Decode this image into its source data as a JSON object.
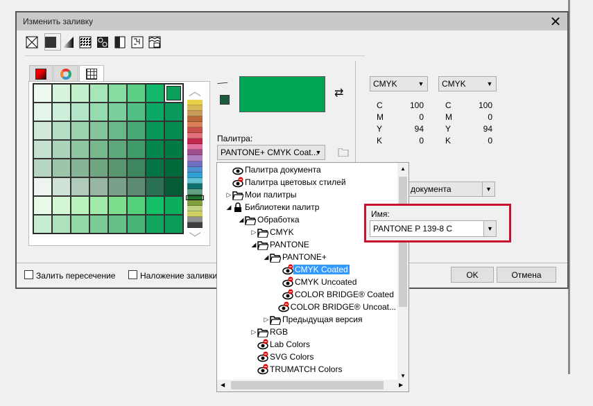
{
  "dialog": {
    "title": "Изменить заливку",
    "close": "✕"
  },
  "fill_types": [
    "no-fill-icon",
    "uniform-fill-icon",
    "fountain-fill-icon",
    "vector-pattern-icon",
    "bitmap-pattern-icon",
    "two-color-pattern-icon",
    "texture-fill-icon",
    "postscript-fill-icon"
  ],
  "tabs": [
    "color-viewers-tab",
    "color-harmonies-tab",
    "color-palettes-tab"
  ],
  "grid": [
    [
      "#eefaf0",
      "#d7f5dd",
      "#c2efcc",
      "#a6e6b8",
      "#86dca0",
      "#5ccf87",
      "#14b86a",
      "#0aa05a"
    ],
    [
      "#e3f4e8",
      "#cdeed8",
      "#b2e5c6",
      "#96dbb0",
      "#79cf9b",
      "#52c084",
      "#0ca866",
      "#079a5a"
    ],
    [
      "#cfe8d8",
      "#b5dfc5",
      "#9cd2b0",
      "#84c59e",
      "#6ab88a",
      "#48aa74",
      "#069658",
      "#058a50"
    ],
    [
      "#c4e2cf",
      "#a9d4b9",
      "#8fc6a2",
      "#77b88f",
      "#5ea97c",
      "#3f9b68",
      "#03864c",
      "#027a44"
    ],
    [
      "#b7d6c2",
      "#9cc6aa",
      "#85b596",
      "#70a582",
      "#58966f",
      "#3e8660",
      "#027543",
      "#016a3b"
    ],
    [
      "#eef4ef",
      "#d0e2d6",
      "#b0cbb9",
      "#97b6a2",
      "#7aa08a",
      "#5d8a72",
      "#2a7052",
      "#055d35"
    ],
    [
      "#e7fae7",
      "#d3f7d2",
      "#baf2bb",
      "#a0ebaa",
      "#7ddf8e",
      "#52d07a",
      "#14c066",
      "#0aae5c"
    ],
    [
      "#c7ebcf",
      "#ade2bb",
      "#92d7a6",
      "#7ccb94",
      "#64c085",
      "#48b473",
      "#10a65e",
      "#089c57"
    ]
  ],
  "strip": [
    "#e8d24a",
    "#d9b85a",
    "#c99a5a",
    "#b86a3a",
    "#d9805a",
    "#c9504a",
    "#e0707a",
    "#c02850",
    "#e070a0",
    "#a05090",
    "#b080c0",
    "#7070c0",
    "#5090d0",
    "#30a0d0",
    "#60c0d0",
    "#107070",
    "#60a080",
    "#207030",
    "#80a040",
    "#c0d080",
    "#d0d060",
    "#909090",
    "#404040"
  ],
  "current_color": "#00a651",
  "palette_label": "Палитра:",
  "palette_value": "PANTONE+ CMYK Coat...",
  "models": [
    {
      "model": "CMYK",
      "values": [
        [
          "C",
          "100"
        ],
        [
          "M",
          "0"
        ],
        [
          "Y",
          "94"
        ],
        [
          "K",
          "0"
        ]
      ]
    },
    {
      "model": "CMYK",
      "values": [
        [
          "C",
          "100"
        ],
        [
          "M",
          "0"
        ],
        [
          "Y",
          "94"
        ],
        [
          "K",
          "0"
        ]
      ]
    }
  ],
  "doc_palette": "документа",
  "name_label": "Имя:",
  "name_value": "PANTONE P 139-8 C",
  "highlight": "#c8102e",
  "fill_intersect": "Залить пересечение",
  "overprint": "Наложение заливки",
  "ok": "OK",
  "cancel": "Отмена",
  "tree": [
    {
      "d": 0,
      "e": "",
      "i": "eye",
      "t": "Палитра документа"
    },
    {
      "d": 0,
      "e": "",
      "i": "eyer",
      "t": "Палитра цветовых стилей"
    },
    {
      "d": 0,
      "e": "▷",
      "i": "folder",
      "t": "Мои палитры"
    },
    {
      "d": 0,
      "e": "◢",
      "i": "lock",
      "t": "Библиотеки палитр"
    },
    {
      "d": 1,
      "e": "◢",
      "i": "folder",
      "t": "Обработка"
    },
    {
      "d": 2,
      "e": "▷",
      "i": "folder",
      "t": "CMYK"
    },
    {
      "d": 2,
      "e": "◢",
      "i": "folder",
      "t": "PANTONE"
    },
    {
      "d": 3,
      "e": "◢",
      "i": "folder",
      "t": "PANTONE+"
    },
    {
      "d": 4,
      "e": "",
      "i": "eyer",
      "t": "CMYK Coated",
      "sel": true
    },
    {
      "d": 4,
      "e": "",
      "i": "eyer",
      "t": "CMYK Uncoated"
    },
    {
      "d": 4,
      "e": "",
      "i": "eyer",
      "t": "COLOR BRIDGE® Coated"
    },
    {
      "d": 4,
      "e": "",
      "i": "eyer",
      "t": "COLOR BRIDGE® Uncoat..."
    },
    {
      "d": 3,
      "e": "▷",
      "i": "folder",
      "t": "Предыдущая версия"
    },
    {
      "d": 2,
      "e": "▷",
      "i": "folder",
      "t": "RGB"
    },
    {
      "d": 2,
      "e": "",
      "i": "eyer",
      "t": "Lab Colors"
    },
    {
      "d": 2,
      "e": "",
      "i": "eyer",
      "t": "SVG Colors"
    },
    {
      "d": 2,
      "e": "",
      "i": "eyer",
      "t": "TRUMATCH Colors"
    }
  ]
}
